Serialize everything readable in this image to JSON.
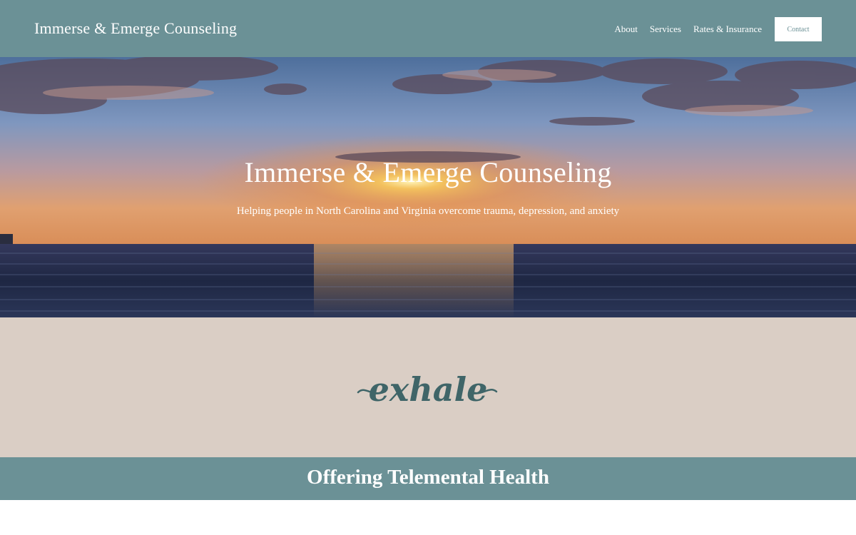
{
  "header": {
    "brand": "Immerse & Emerge Counseling",
    "nav": {
      "about": "About",
      "services": "Services",
      "rates": "Rates & Insurance",
      "contact": "Contact"
    }
  },
  "hero": {
    "title": "Immerse & Emerge Counseling",
    "subtitle": "Helping people in North Carolina and Virginia overcome trauma, depression, and anxiety"
  },
  "exhale": {
    "word": "exhale"
  },
  "telehealth": {
    "title": "Offering Telemental Health"
  },
  "colors": {
    "header": "#6b9196",
    "exhale_band": "#dacec5",
    "script_text": "#3f6568"
  }
}
